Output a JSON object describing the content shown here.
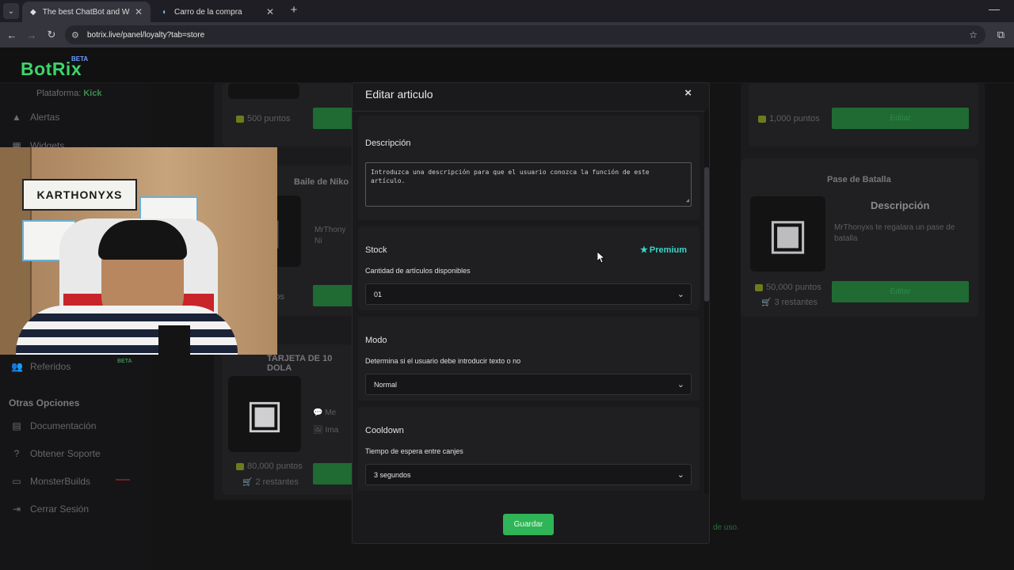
{
  "browser": {
    "tabs": [
      {
        "title": "The best ChatBot and Widgets f",
        "favicon": "botrix-icon",
        "active": true
      },
      {
        "title": "Carro de la compra",
        "favicon": "steam-icon",
        "active": false
      }
    ],
    "url": "botrix.live/panel/loyalty?tab=store"
  },
  "app": {
    "logo": "BotRix",
    "beta": "BETA",
    "accent": "#3ed46a"
  },
  "sidebar": {
    "platform_label": "Plataforma:",
    "platform_value": "Kick",
    "items": [
      {
        "label": "Alertas",
        "icon": "warning-icon"
      },
      {
        "label": "Widgets",
        "icon": "widgets-icon"
      },
      {
        "label": "Referidos",
        "icon": "users-icon"
      }
    ],
    "beta_badge": "BETA",
    "section": "Otras Opciones",
    "other_items": [
      {
        "label": "Documentación",
        "icon": "document-icon"
      },
      {
        "label": "Obtener Soporte",
        "icon": "help-icon"
      },
      {
        "label": "MonsterBuilds",
        "icon": "monitor-icon"
      },
      {
        "label": "Cerrar Sesión",
        "icon": "logout-icon"
      }
    ]
  },
  "store": {
    "left_cards": [
      {
        "title": "",
        "price": "500 puntos",
        "stock": ""
      },
      {
        "title": "Baile de Niko",
        "price": "untos",
        "stock": "",
        "desc": "MrThony Ni"
      },
      {
        "title": "TARJETA DE 10 DOLA",
        "price": "80,000 puntos",
        "stock": "2 restantes",
        "desc1": "Me",
        "desc2": "Ima"
      }
    ],
    "right_cards": [
      {
        "title": "",
        "price": "1,000 puntos",
        "button": "Editar"
      },
      {
        "title": "Pase de Batalla",
        "desc_heading": "Descripción",
        "desc": "MrThonyxs te regalara un pase de batalla",
        "price": "50,000 puntos",
        "stock": "3 restantes",
        "button": "Editar"
      }
    ],
    "terms_fragment": "de uso."
  },
  "modal": {
    "title": "Editar articulo",
    "close": "×",
    "description": {
      "title": "Descripción",
      "placeholder": "Introduzca una descripción para que el usuario conozca la función de este artículo."
    },
    "stock": {
      "title": "Stock",
      "premium": "Premium",
      "label": "Cantidad de artículos disponibles",
      "value": "01"
    },
    "mode": {
      "title": "Modo",
      "label": "Determina si el usuario debe introducir texto o no",
      "value": "Normal"
    },
    "cooldown": {
      "title": "Cooldown",
      "label": "Tiempo de espera entre canjes",
      "value": "3 segundos"
    },
    "save": "Guardar"
  }
}
